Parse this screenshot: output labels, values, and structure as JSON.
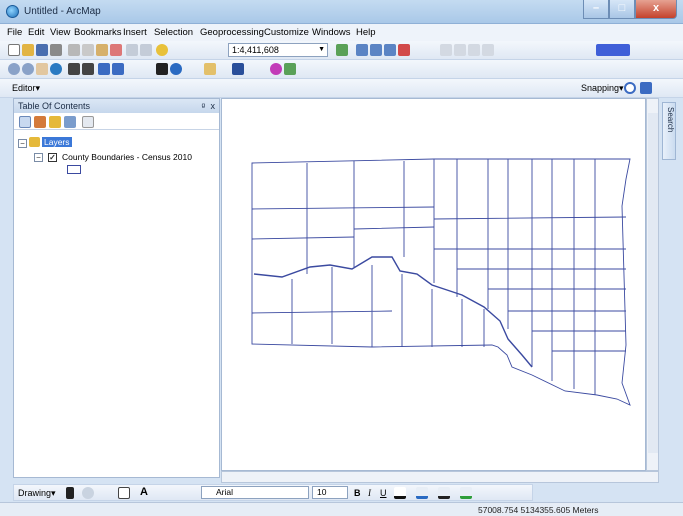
{
  "window": {
    "title": "Untitled - ArcMap",
    "minimize": "–",
    "maximize": "□",
    "close": "x"
  },
  "menu": [
    "File",
    "Edit",
    "View",
    "Bookmarks",
    "Insert",
    "Selection",
    "Geoprocessing",
    "Customize",
    "Windows",
    "Help"
  ],
  "toolbar": {
    "scale": "1:4,411,608",
    "editor": "Editor▾",
    "snapping": "Snapping▾"
  },
  "toc": {
    "title": "Table Of Contents",
    "pin": "ᵍ",
    "close": "x",
    "layers": "Layers",
    "layer": "County Boundaries - Census 2010",
    "layer_checked": true
  },
  "side_tab": "Search",
  "drawing": {
    "label": "Drawing▾",
    "font": "Arial",
    "size": "10",
    "bold": "B",
    "italic": "I",
    "underline": "U",
    "text_tool": "A"
  },
  "status": {
    "coordinates": "57008.754  5134355.605 Meters"
  },
  "colors": {
    "county_line": "#3b4aa0",
    "selection": "#3b78d8"
  }
}
